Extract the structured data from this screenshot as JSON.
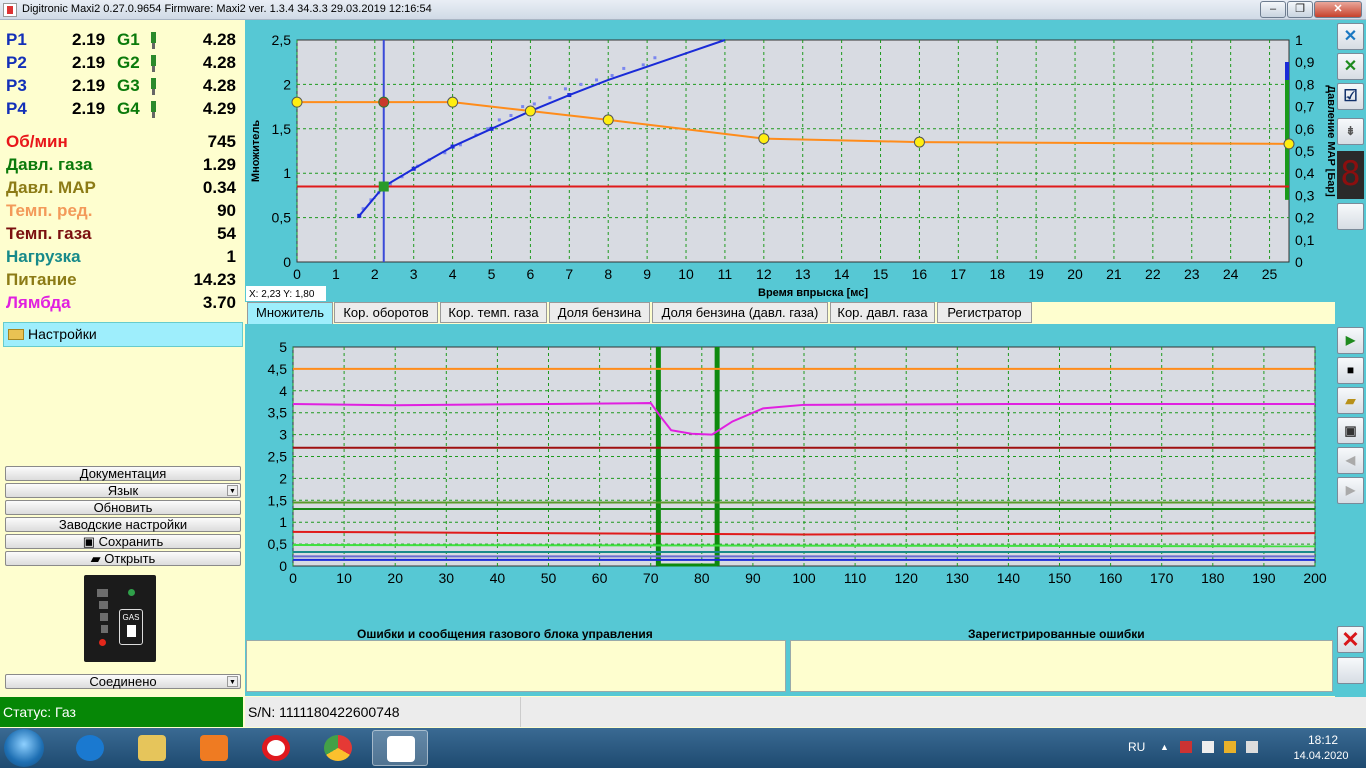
{
  "window": {
    "title": "Digitronic Maxi2 0.27.0.9654 Firmware: Maxi2  ver. 1.3.4  34.3.3  29.03.2019 12:16:54",
    "min": "‒",
    "max": "❐",
    "close": "✕"
  },
  "injectors": [
    {
      "p_label": "P1",
      "p_value": "2.19",
      "g_label": "G1",
      "g_value": "4.28"
    },
    {
      "p_label": "P2",
      "p_value": "2.19",
      "g_label": "G2",
      "g_value": "4.28"
    },
    {
      "p_label": "P3",
      "p_value": "2.19",
      "g_label": "G3",
      "g_value": "4.28"
    },
    {
      "p_label": "P4",
      "p_value": "2.19",
      "g_label": "G4",
      "g_value": "4.29"
    }
  ],
  "params": [
    {
      "label": "Об/мин",
      "value": "745",
      "color": "#e8161a"
    },
    {
      "label": "Давл. газа",
      "value": "1.29",
      "color": "#0b7a0b"
    },
    {
      "label": "Давл. MAP",
      "value": "0.34",
      "color": "#8c7b16"
    },
    {
      "label": "Темп. ред.",
      "value": "90",
      "color": "#f39a5a"
    },
    {
      "label": "Темп. газа",
      "value": "54",
      "color": "#7b1010"
    },
    {
      "label": "Нагрузка",
      "value": "1",
      "color": "#178a8a"
    },
    {
      "label": "Питание",
      "value": "14.23",
      "color": "#8c7b16"
    },
    {
      "label": "Лямбда",
      "value": "3.70",
      "color": "#e020e0"
    }
  ],
  "settings": {
    "header": "Настройки"
  },
  "buttons": {
    "documentation": "Документация",
    "language": "Язык",
    "refresh": "Обновить",
    "factory": "Заводские настройки",
    "save": "Сохранить",
    "open": "Открыть",
    "connection": "Соединено"
  },
  "gas_switch": {
    "label": "GAS"
  },
  "top_chart_text": {
    "ylabel": "Множитель",
    "y2label": "Давление MAP [Бар]",
    "xlabel": "Время впрыска [мс]",
    "readout": "X: 2,23  Y: 1,80"
  },
  "tabs": [
    "Множитель",
    "Кор. оборотов",
    "Кор. темп. газа",
    "Доля бензина",
    "Доля бензина (давл. газа)",
    "Кор. давл. газа",
    "Регистратор"
  ],
  "errors": {
    "left_title": "Ошибки и сообщения газового блока управления",
    "right_title": "Зарегистрированные ошибки"
  },
  "status": {
    "mode": "Статус: Газ",
    "serial": "S/N: 1111180422600748"
  },
  "tray": {
    "lang": "RU",
    "time": "18:12",
    "date": "14.04.2020"
  },
  "taskbar_apps": [
    {
      "name": "internet-explorer",
      "color": "#1a79d0"
    },
    {
      "name": "file-explorer",
      "color": "#e6c55b"
    },
    {
      "name": "media-player",
      "color": "#ef7b22"
    },
    {
      "name": "opera",
      "color": "#e0191f"
    },
    {
      "name": "chrome",
      "color": "#3d9e45"
    },
    {
      "name": "digitronic",
      "color": "#d8362a"
    }
  ],
  "chart_data": [
    {
      "type": "line",
      "title": "",
      "xlabel": "Время впрыска [мс]",
      "ylabel": "Множитель",
      "y2label": "Давление MAP [Бар]",
      "xlim": [
        0,
        25.5
      ],
      "ylim": [
        0,
        2.5
      ],
      "y2lim": [
        0,
        1
      ],
      "xticks": [
        0,
        1,
        2,
        3,
        4,
        5,
        6,
        7,
        8,
        9,
        10,
        11,
        12,
        13,
        14,
        15,
        16,
        17,
        18,
        19,
        20,
        21,
        22,
        23,
        24,
        25
      ],
      "yticks": [
        "0",
        "0,5",
        "1",
        "1,5",
        "2",
        "2,5"
      ],
      "y2ticks": [
        "0",
        "0,1",
        "0,2",
        "0,3",
        "0,4",
        "0,5",
        "0,6",
        "0,7",
        "0,8",
        "0,9",
        "1"
      ],
      "grid": true,
      "cursor_x": 2.23,
      "map_level_y": 0.85,
      "multiplier_series": {
        "name": "",
        "color": "#ff8c1a",
        "x": [
          0,
          2.23,
          4,
          6,
          8,
          12,
          16,
          25.5
        ],
        "y": [
          1.8,
          1.8,
          1.8,
          1.7,
          1.6,
          1.39,
          1.35,
          1.33
        ]
      },
      "petrol_gas_curve": {
        "color": "#1a2bd8",
        "x": [
          1.6,
          2.23,
          3,
          4,
          5,
          6,
          7,
          8,
          9,
          10,
          11
        ],
        "y": [
          0.52,
          0.85,
          1.05,
          1.3,
          1.5,
          1.7,
          1.88,
          2.05,
          2.2,
          2.35,
          2.5
        ]
      },
      "scatter_points": {
        "color": "#7a86ef",
        "x": [
          1.7,
          1.9,
          2.1,
          2.4,
          2.7,
          3.1,
          3.4,
          3.8,
          4.2,
          4.6,
          4.9,
          5.2,
          5.5,
          5.8,
          6.1,
          6.5,
          6.9,
          7.3,
          7.7,
          8.1,
          8.4,
          8.9,
          9.2
        ],
        "y": [
          0.6,
          0.7,
          0.78,
          0.88,
          0.96,
          1.08,
          1.15,
          1.23,
          1.32,
          1.43,
          1.5,
          1.6,
          1.65,
          1.75,
          1.78,
          1.85,
          1.95,
          2.0,
          2.05,
          2.1,
          2.18,
          2.22,
          2.3
        ]
      }
    },
    {
      "type": "line",
      "title": "",
      "xlabel": "",
      "ylabel": "",
      "xlim": [
        0,
        200
      ],
      "ylim": [
        0,
        5
      ],
      "xticks": [
        0,
        10,
        20,
        30,
        40,
        50,
        60,
        70,
        80,
        90,
        100,
        110,
        120,
        130,
        140,
        150,
        160,
        170,
        180,
        190,
        200
      ],
      "yticks": [
        "0",
        "0,5",
        "1",
        "1,5",
        "2",
        "2,5",
        "3",
        "3,5",
        "4",
        "4,5",
        "5"
      ],
      "grid": true,
      "event_window": [
        71.5,
        83
      ],
      "series": [
        {
          "name": "",
          "color": "#ff8c1a",
          "x": [
            0,
            200
          ],
          "y": [
            4.5,
            4.5
          ]
        },
        {
          "name": "",
          "color": "#e020e0",
          "x": [
            0,
            20,
            50,
            70,
            72,
            74,
            78,
            82,
            86,
            92,
            100,
            140,
            200
          ],
          "y": [
            3.7,
            3.67,
            3.7,
            3.72,
            3.4,
            3.1,
            3.02,
            3.0,
            3.3,
            3.6,
            3.68,
            3.7,
            3.7
          ]
        },
        {
          "name": "",
          "color": "#a01010",
          "x": [
            0,
            200
          ],
          "y": [
            2.7,
            2.7
          ]
        },
        {
          "name": "",
          "color": "#1a8a1a",
          "x": [
            0,
            200
          ],
          "y": [
            1.3,
            1.3
          ]
        },
        {
          "name": "",
          "color": "#5a9a2a",
          "x": [
            0,
            200
          ],
          "y": [
            1.45,
            1.45
          ]
        },
        {
          "name": "",
          "color": "#e01a1a",
          "x": [
            0,
            100,
            200
          ],
          "y": [
            0.78,
            0.72,
            0.75
          ]
        },
        {
          "name": "",
          "color": "#40e040",
          "x": [
            0,
            200
          ],
          "y": [
            0.48,
            0.45
          ]
        },
        {
          "name": "",
          "color": "#1a8a8a",
          "x": [
            0,
            200
          ],
          "y": [
            0.32,
            0.32
          ]
        },
        {
          "name": "",
          "color": "#6a6ad0",
          "x": [
            0,
            200
          ],
          "y": [
            0.22,
            0.22
          ]
        },
        {
          "name": "",
          "color": "#1a2bd8",
          "x": [
            0,
            200
          ],
          "y": [
            0.14,
            0.14
          ]
        }
      ]
    }
  ]
}
